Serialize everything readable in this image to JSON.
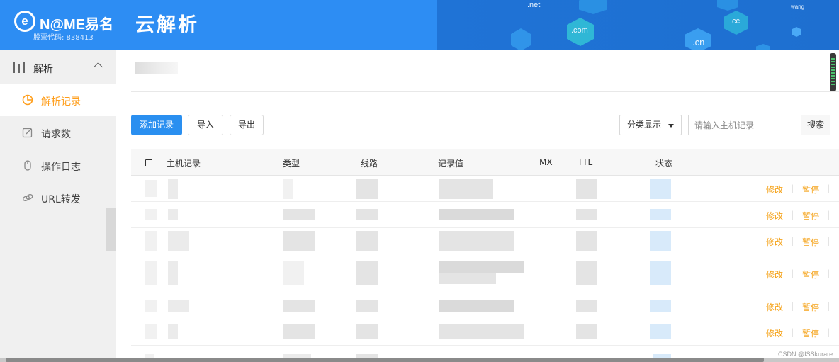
{
  "header": {
    "logo_mark": "e",
    "logo_text": "N@ME易名",
    "logo_sub": "股票代码: 838413",
    "app_title": "云解析",
    "deco_tlds": [
      ".net",
      ".com",
      ".cn",
      ".cc",
      "wang"
    ]
  },
  "sidebar": {
    "group": {
      "label": "解析",
      "icon": "sliders-icon",
      "expanded": true
    },
    "items": [
      {
        "label": "解析记录",
        "icon": "pie-chart-icon",
        "active": true
      },
      {
        "label": "请求数",
        "icon": "edit-icon",
        "active": false
      },
      {
        "label": "操作日志",
        "icon": "mouse-icon",
        "active": false
      },
      {
        "label": "URL转发",
        "icon": "link-icon",
        "active": false
      }
    ]
  },
  "toolbar": {
    "add_label": "添加记录",
    "import_label": "导入",
    "export_label": "导出",
    "category_select": "分类显示",
    "search_placeholder": "请输入主机记录",
    "search_label": "搜索"
  },
  "table": {
    "columns": [
      "主机记录",
      "类型",
      "线路",
      "记录值",
      "MX",
      "TTL",
      "状态"
    ],
    "rows": [
      {
        "edit": "修改",
        "pause": "暂停",
        "sep": "|"
      },
      {
        "edit": "修改",
        "pause": "暂停",
        "sep": "|"
      },
      {
        "edit": "修改",
        "pause": "暂停",
        "sep": "|"
      },
      {
        "edit": "修改",
        "pause": "暂停",
        "sep": "|"
      },
      {
        "edit": "修改",
        "pause": "暂停",
        "sep": "|"
      },
      {
        "edit": "修改",
        "pause": "暂停",
        "sep": "|"
      }
    ]
  },
  "watermark": "CSDN @ISSkurare",
  "colors": {
    "brand_blue": "#2d8df3",
    "accent_orange": "#f5a31a",
    "primary_button": "#2a8ff0"
  }
}
